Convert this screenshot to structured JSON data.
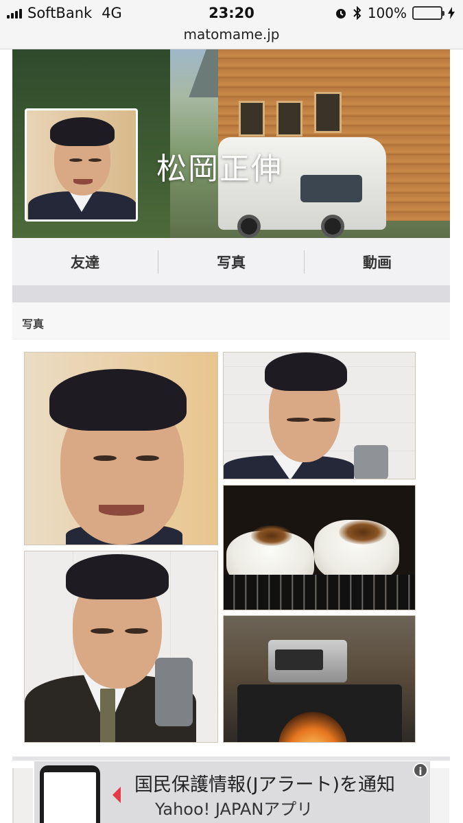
{
  "status_bar": {
    "carrier": "SoftBank",
    "network": "4G",
    "time": "23:20",
    "battery": "100%",
    "battery_level": 1.0
  },
  "browser": {
    "url": "matomame.jp"
  },
  "profile": {
    "name": "松岡正伸",
    "tabs": [
      "友達",
      "写真",
      "動画"
    ]
  },
  "section": {
    "title": "写真"
  },
  "ad": {
    "line1": "国民保護情報(Jアラート)を通知",
    "line2": "Yahoo! JAPANアプリ",
    "info_icon": "i",
    "accent_color": "#e23b4a"
  }
}
